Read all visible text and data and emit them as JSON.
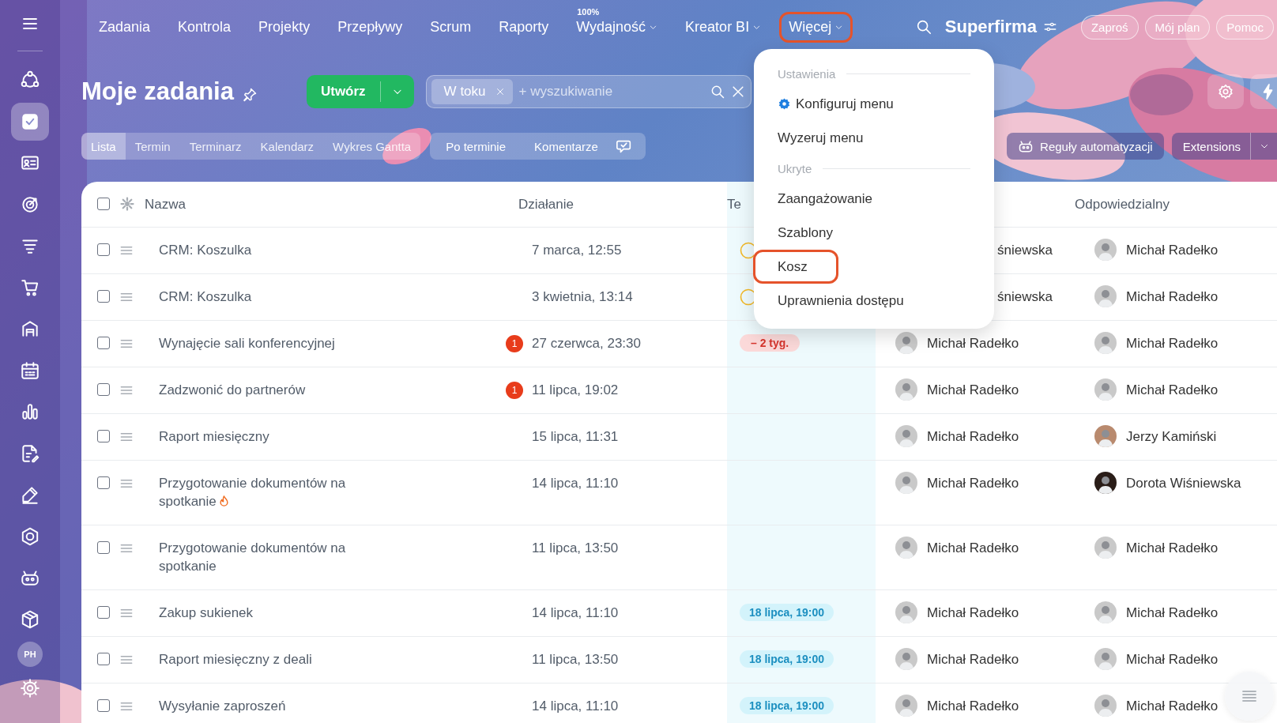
{
  "sidebar": {
    "items": [
      {
        "selected": false
      },
      {
        "selected": true
      },
      {
        "selected": false
      },
      {
        "selected": false
      },
      {
        "selected": false
      },
      {
        "selected": false
      },
      {
        "selected": false
      },
      {
        "selected": false
      },
      {
        "selected": false
      },
      {
        "selected": false
      },
      {
        "selected": false
      },
      {
        "selected": false
      },
      {
        "selected": false
      },
      {
        "selected": false
      }
    ],
    "avatar": "PH"
  },
  "top_nav": {
    "items": [
      {
        "label": "Zadania",
        "dropdown": false,
        "highlighted": false
      },
      {
        "label": "Kontrola",
        "dropdown": false,
        "highlighted": false
      },
      {
        "label": "Projekty",
        "dropdown": false,
        "highlighted": false
      },
      {
        "label": "Przepływy",
        "dropdown": false,
        "highlighted": false
      },
      {
        "label": "Scrum",
        "dropdown": false,
        "highlighted": false
      },
      {
        "label": "Raporty",
        "dropdown": false,
        "highlighted": false
      },
      {
        "label": "Wydajność",
        "superscript": "100%",
        "dropdown": true,
        "highlighted": false
      },
      {
        "label": "Kreator BI",
        "dropdown": true,
        "highlighted": false
      },
      {
        "label": "Więcej",
        "dropdown": true,
        "highlighted": true
      }
    ],
    "company": "Superfirma",
    "buttons": [
      "Zaproś",
      "Mój plan",
      "Pomoc"
    ]
  },
  "header": {
    "title": "Moje zadania",
    "create_button": "Utwórz",
    "filter": {
      "chips": [
        "W toku"
      ],
      "placeholder": "+ wyszukiwanie"
    }
  },
  "view_tabs": [
    {
      "label": "Lista",
      "selected": true
    },
    {
      "label": "Termin",
      "selected": false
    },
    {
      "label": "Terminarz",
      "selected": false
    },
    {
      "label": "Kalendarz",
      "selected": false
    },
    {
      "label": "Wykres Gantta",
      "selected": false
    }
  ],
  "sort_tabs": [
    "Po terminie",
    "Komentarze"
  ],
  "toolbar_right": {
    "automation": "Reguły automatyzacji",
    "extensions": "Extensions"
  },
  "table": {
    "all_checked": false,
    "columns": [
      "Nazwa",
      "Działanie",
      "Te",
      "Odpowiedzialny"
    ],
    "rows": [
      {
        "checked": false,
        "name": "CRM: Koszulka",
        "hot": false,
        "date": "7 marca, 12:55",
        "termin": {
          "kind": "pending"
        },
        "creator": {
          "name": "śniewska"
        },
        "responsible": {
          "name": "Michał Radełko",
          "color": "#c9c9c9"
        }
      },
      {
        "checked": false,
        "name": "CRM: Koszulka",
        "hot": false,
        "date": "3 kwietnia, 13:14",
        "termin": {
          "kind": "pending"
        },
        "creator": {
          "name": "śniewska"
        },
        "responsible": {
          "name": "Michał Radełko",
          "color": "#c9c9c9"
        }
      },
      {
        "checked": false,
        "name": "Wynajęcie sali konferencyjnej",
        "hot": false,
        "counter": "1",
        "date": "27 czerwca, 23:30",
        "termin": {
          "kind": "overdue",
          "text": "– 2 tyg."
        },
        "creator": {
          "name": "Michał Radełko",
          "color": "#c9c9c9"
        },
        "responsible": {
          "name": "Michał Radełko",
          "color": "#c9c9c9"
        }
      },
      {
        "checked": false,
        "name": "Zadzwonić do partnerów",
        "hot": false,
        "counter": "1",
        "date": "11 lipca, 19:02",
        "creator": {
          "name": "Michał Radełko",
          "color": "#c9c9c9"
        },
        "responsible": {
          "name": "Michał Radełko",
          "color": "#c9c9c9"
        }
      },
      {
        "checked": false,
        "name": "Raport miesięczny",
        "hot": false,
        "date": "15 lipca, 11:31",
        "creator": {
          "name": "Michał Radełko",
          "color": "#c9c9c9"
        },
        "responsible": {
          "name": "Jerzy Kamiński",
          "color": "#b98a6e"
        }
      },
      {
        "checked": false,
        "name": "Przygotowanie dokumentów na spotkanie",
        "hot": true,
        "date": "14 lipca, 11:10",
        "creator": {
          "name": "Michał Radełko",
          "color": "#c9c9c9"
        },
        "responsible": {
          "name": "Dorota Wiśniewska",
          "color": "#2a1d18"
        }
      },
      {
        "checked": false,
        "name": "Przygotowanie dokumentów na spotkanie",
        "hot": false,
        "date": "11 lipca, 13:50",
        "creator": {
          "name": "Michał Radełko",
          "color": "#c9c9c9"
        },
        "responsible": {
          "name": "Michał Radełko",
          "color": "#c9c9c9"
        }
      },
      {
        "checked": false,
        "name": "Zakup sukienek",
        "hot": false,
        "date": "14 lipca, 11:10",
        "termin": {
          "kind": "date",
          "text": "18 lipca, 19:00"
        },
        "creator": {
          "name": "Michał Radełko",
          "color": "#c9c9c9"
        },
        "responsible": {
          "name": "Michał Radełko",
          "color": "#c9c9c9"
        }
      },
      {
        "checked": false,
        "name": "Raport miesięczny z deali",
        "hot": false,
        "date": "11 lipca, 13:50",
        "termin": {
          "kind": "date",
          "text": "18 lipca, 19:00"
        },
        "creator": {
          "name": "Michał Radełko",
          "color": "#c9c9c9"
        },
        "responsible": {
          "name": "Michał Radełko",
          "color": "#c9c9c9"
        }
      },
      {
        "checked": false,
        "name": "Wysyłanie zaproszeń",
        "hot": false,
        "date": "14 lipca, 11:10",
        "termin": {
          "kind": "date",
          "text": "18 lipca, 19:00"
        },
        "creator": {
          "name": "Michał Radełko",
          "color": "#c9c9c9"
        },
        "responsible": {
          "name": "Michał Radełko",
          "color": "#c9c9c9"
        }
      }
    ]
  },
  "menu": {
    "sections": [
      {
        "heading": "Ustawienia",
        "items": [
          {
            "label": "Konfiguruj menu",
            "kind": "config",
            "highlighted": false
          },
          {
            "label": "Wyzeruj menu",
            "kind": "plain",
            "highlighted": false
          }
        ]
      },
      {
        "heading": "Ukryte",
        "items": [
          {
            "label": "Zaangażowanie",
            "kind": "plain",
            "highlighted": false
          },
          {
            "label": "Szablony",
            "kind": "plain",
            "highlighted": false
          },
          {
            "label": "Kosz",
            "kind": "plain",
            "highlighted": true
          },
          {
            "label": "Uprawnienia dostępu",
            "kind": "plain",
            "highlighted": false
          }
        ]
      }
    ]
  }
}
